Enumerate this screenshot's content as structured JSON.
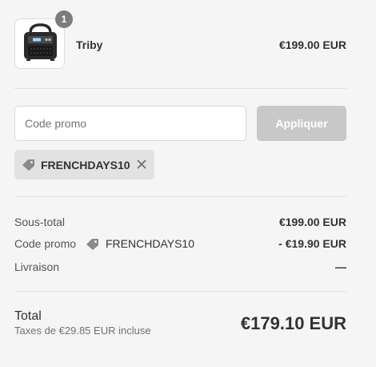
{
  "product": {
    "quantity": "1",
    "name": "Triby",
    "price": "€199.00 EUR"
  },
  "promo": {
    "placeholder": "Code promo",
    "apply_label": "Appliquer",
    "applied_code": "FRENCHDAYS10"
  },
  "summary": {
    "subtotal_label": "Sous-total",
    "subtotal_value": "€199.00 EUR",
    "promo_label": "Code promo",
    "promo_code": "FRENCHDAYS10",
    "promo_value": "- €19.90 EUR",
    "shipping_label": "Livraison",
    "shipping_value": "—"
  },
  "total": {
    "label": "Total",
    "taxes": "Taxes de €29.85 EUR incluse",
    "value": "€179.10 EUR"
  },
  "colors": {
    "background": "#f5f5f5",
    "badge": "#7c7c7c",
    "disabled_button": "#c8c8c8",
    "tag_background": "#e2e2e2"
  },
  "icons": [
    "speaker-product-image",
    "tag-icon",
    "close-icon"
  ]
}
